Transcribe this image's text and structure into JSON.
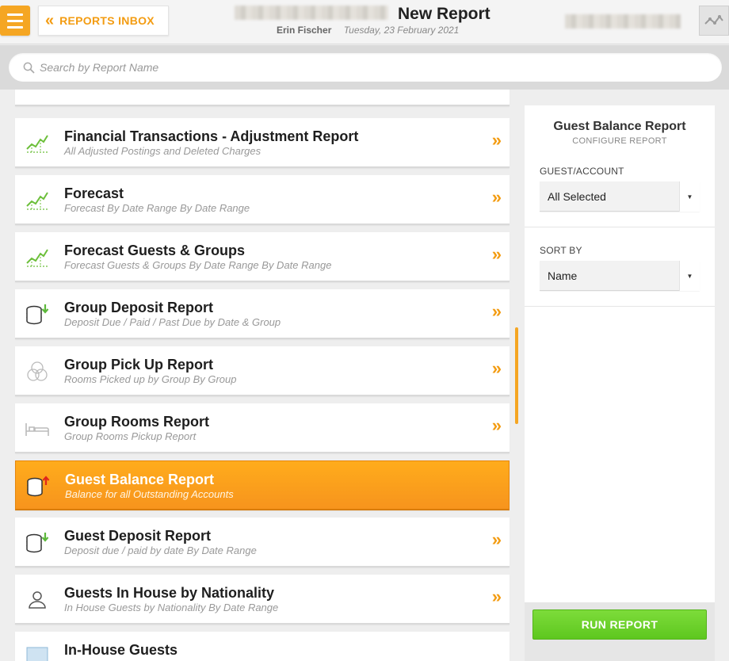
{
  "header": {
    "menu_icon": "hamburger-icon",
    "back_label": "REPORTS INBOX",
    "back_icon": "double-chevron-left-icon",
    "page_title": "New Report",
    "user_name": "Erin Fischer",
    "date": "Tuesday, 23 February 2021",
    "activity_icon": "activity-graph-icon"
  },
  "search": {
    "placeholder": "Search by Report Name",
    "value": "",
    "icon": "search-icon"
  },
  "reports": [
    {
      "title": "Financial Transactions - Adjustment Report",
      "subtitle": "All Adjusted Postings and Deleted Charges",
      "icon": "trend-chart-icon"
    },
    {
      "title": "Forecast",
      "subtitle": "Forecast By Date Range By Date Range",
      "icon": "trend-chart-icon"
    },
    {
      "title": "Forecast Guests & Groups",
      "subtitle": "Forecast Guests & Groups By Date Range By Date Range",
      "icon": "trend-chart-icon"
    },
    {
      "title": "Group Deposit Report",
      "subtitle": "Deposit Due / Paid / Past Due by Date & Group",
      "icon": "coins-down-icon"
    },
    {
      "title": "Group Pick Up Report",
      "subtitle": "Rooms Picked up by Group By Group",
      "icon": "circles-icon"
    },
    {
      "title": "Group Rooms Report",
      "subtitle": "Group Rooms Pickup Report",
      "icon": "bed-icon"
    },
    {
      "title": "Guest Balance Report",
      "subtitle": "Balance for all Outstanding Accounts",
      "icon": "coins-up-icon",
      "selected": true
    },
    {
      "title": "Guest Deposit Report",
      "subtitle": "Deposit due / paid by date By Date Range",
      "icon": "coins-down-icon"
    },
    {
      "title": "Guests In House by Nationality",
      "subtitle": "In House Guests by Nationality By Date Range",
      "icon": "person-icon"
    },
    {
      "title": "In-House Guests",
      "subtitle": "",
      "icon": "card-icon"
    }
  ],
  "panel": {
    "title": "Guest Balance Report",
    "subtitle": "CONFIGURE REPORT",
    "guest_label": "GUEST/ACCOUNT",
    "guest_value": "All Selected",
    "sort_label": "SORT BY",
    "sort_value": "Name",
    "run_label": "RUN REPORT"
  },
  "colors": {
    "accent": "#f39c12",
    "selected_row": "#f7941d",
    "run_button": "#6fd22b",
    "trend_icon": "#6cbf3a"
  }
}
